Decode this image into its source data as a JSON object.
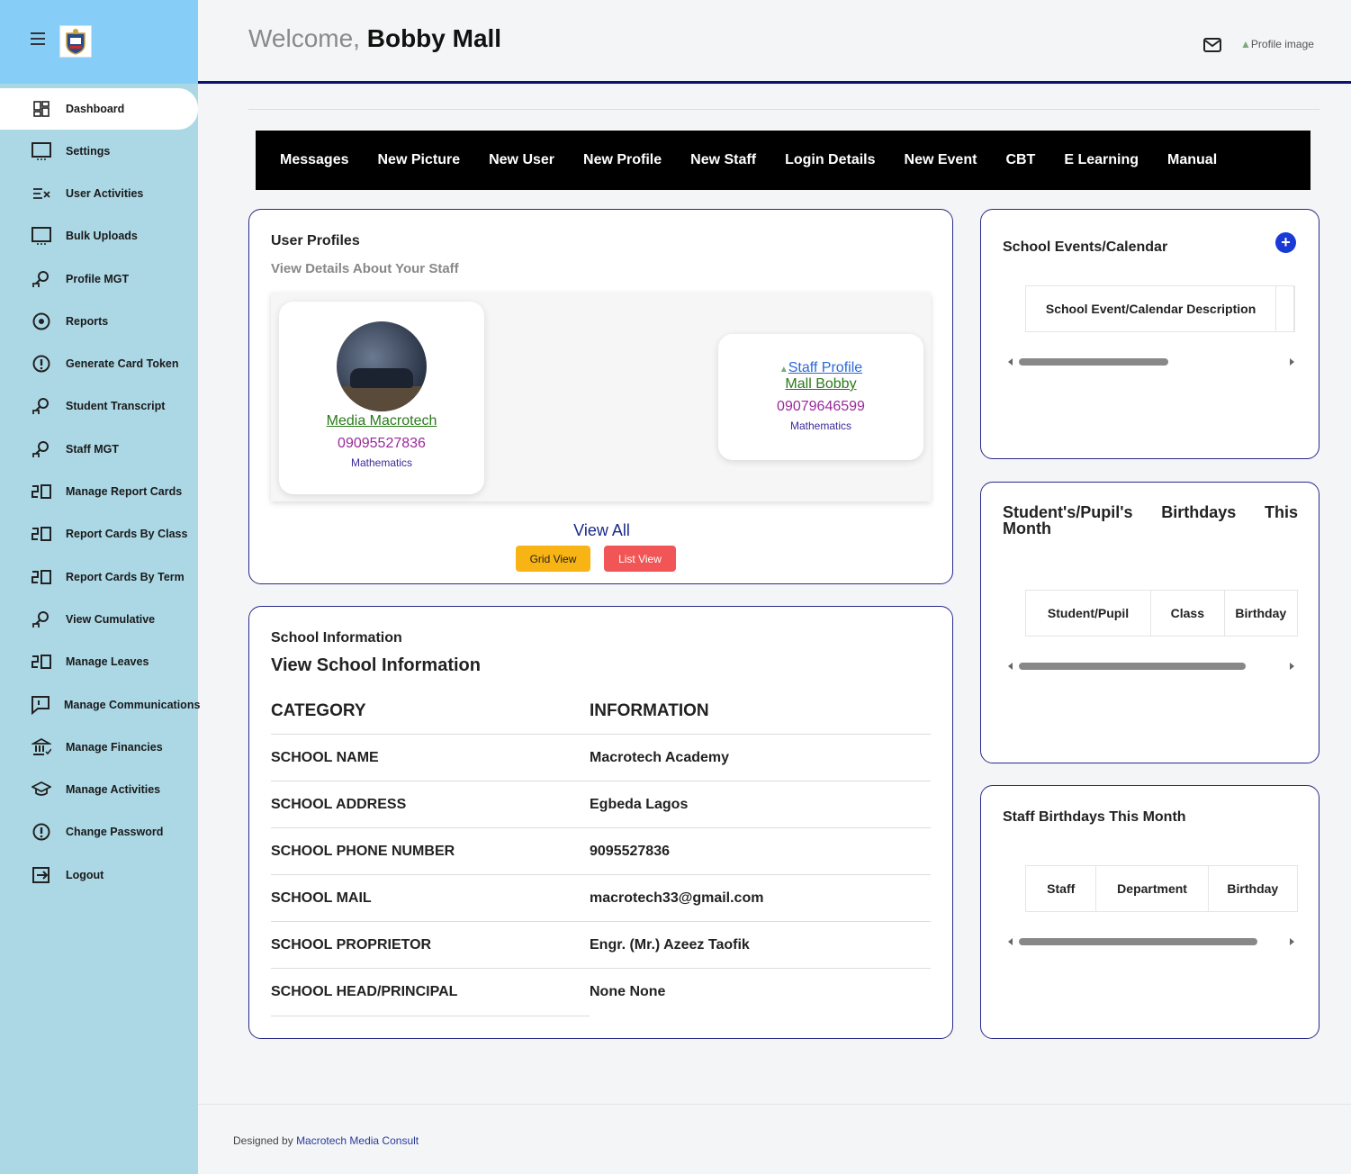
{
  "header": {
    "welcome_prefix": "Welcome,",
    "user_name": "Bobby Mall",
    "profile_image_alt": "Profile image"
  },
  "sidebar": {
    "items": [
      {
        "label": "Dashboard",
        "icon": "dashboard-icon"
      },
      {
        "label": "Settings",
        "icon": "monitor-icon"
      },
      {
        "label": "User Activities",
        "icon": "list-check-icon"
      },
      {
        "label": "Bulk Uploads",
        "icon": "monitor-icon"
      },
      {
        "label": "Profile MGT",
        "icon": "person-search-icon"
      },
      {
        "label": "Reports",
        "icon": "radio-circle-icon"
      },
      {
        "label": "Generate Card Token",
        "icon": "info-circle-icon"
      },
      {
        "label": "Student Transcript",
        "icon": "person-search-icon"
      },
      {
        "label": "Staff MGT",
        "icon": "person-search-icon"
      },
      {
        "label": "Manage Report Cards",
        "icon": "report-card-icon"
      },
      {
        "label": "Report Cards By Class",
        "icon": "report-card-icon"
      },
      {
        "label": "Report Cards By Term",
        "icon": "report-card-icon"
      },
      {
        "label": "View Cumulative",
        "icon": "person-search-icon"
      },
      {
        "label": "Manage Leaves",
        "icon": "report-card-icon"
      },
      {
        "label": "Manage Communications",
        "icon": "chat-icon"
      },
      {
        "label": "Manage Financies",
        "icon": "bank-icon"
      },
      {
        "label": "Manage Activities",
        "icon": "graduation-cap-icon"
      },
      {
        "label": "Change Password",
        "icon": "info-circle-icon"
      },
      {
        "label": "Logout",
        "icon": "logout-icon"
      }
    ]
  },
  "toolbar": {
    "links": [
      "Messages",
      "New Picture",
      "New User",
      "New Profile",
      "New Staff",
      "Login Details",
      "New Event",
      "CBT",
      "E Learning",
      "Manual"
    ]
  },
  "profiles": {
    "title": "User Profiles",
    "subtitle": "View Details About Your Staff",
    "staff": [
      {
        "name": "Media Macrotech",
        "phone": "09095527836",
        "dept": "Mathematics"
      },
      {
        "image_alt": "Staff Profile",
        "name": "Mall Bobby",
        "phone": "09079646599",
        "dept": "Mathematics"
      }
    ],
    "view_all": "View All",
    "grid_view": "Grid View",
    "list_view": "List View"
  },
  "school_info": {
    "title": "School Information",
    "subtitle": "View School Information",
    "col_category": "CATEGORY",
    "col_information": "INFORMATION",
    "rows": [
      {
        "category": "SCHOOL NAME",
        "value": "Macrotech Academy"
      },
      {
        "category": "SCHOOL ADDRESS",
        "value": "Egbeda Lagos"
      },
      {
        "category": "SCHOOL PHONE NUMBER",
        "value": "9095527836"
      },
      {
        "category": "SCHOOL MAIL",
        "value": "macrotech33@gmail.com"
      },
      {
        "category": "SCHOOL PROPRIETOR",
        "value": "Engr. (Mr.) Azeez Taofik"
      },
      {
        "category": "SCHOOL HEAD/PRINCIPAL",
        "value": "None None"
      }
    ]
  },
  "events": {
    "title": "School Events/Calendar",
    "col1": "School Event/Calendar Description"
  },
  "student_birthdays": {
    "title_w1": "Student's/Pupil's",
    "title_w2": "Birthdays",
    "title_w3": "This",
    "title_w4": "Month",
    "cols": [
      "Student/Pupil",
      "Class",
      "Birthday"
    ]
  },
  "staff_birthdays": {
    "title": "Staff Birthdays This Month",
    "cols": [
      "Staff",
      "Department",
      "Birthday"
    ]
  },
  "footer": {
    "prefix": "Designed by",
    "link": "Macrotech Media Consult"
  }
}
